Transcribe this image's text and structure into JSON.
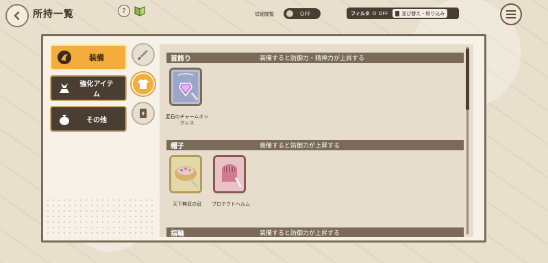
{
  "header": {
    "title": "所持一覧",
    "detail_label": "詳細閲覧",
    "detail_toggle": "OFF",
    "filter_label": "フィルタ",
    "filter_state": "OFF",
    "sort_label": "並び替え・絞り込み"
  },
  "categories": [
    {
      "label": "装備",
      "icon": "equipment-icon",
      "active": true
    },
    {
      "label": "強化アイテム",
      "icon": "enhance-item-icon",
      "active": false
    },
    {
      "label": "その他",
      "icon": "bag-icon",
      "active": false
    }
  ],
  "subfilters": [
    {
      "icon": "sword-icon",
      "active": false
    },
    {
      "icon": "shirt-icon",
      "active": true
    },
    {
      "icon": "card-icon",
      "active": false
    }
  ],
  "sections": [
    {
      "name": "首飾り",
      "description": "装備すると防御力・精神力が上昇する",
      "items": [
        {
          "name": "変石のチャームネックレス",
          "icon": "charm-necklace-icon"
        }
      ]
    },
    {
      "name": "帽子",
      "description": "装備すると防御力が上昇する",
      "items": [
        {
          "name": "天下無双の冠",
          "icon": "crown-icon"
        },
        {
          "name": "プロテクトヘルム",
          "icon": "helmet-icon"
        }
      ]
    },
    {
      "name": "指輪",
      "description": "装備すると防御力が上昇する",
      "items": []
    }
  ],
  "colors": {
    "accent": "#f3ad3c",
    "dark": "#4a3d31",
    "panel": "#f7f2e8"
  }
}
